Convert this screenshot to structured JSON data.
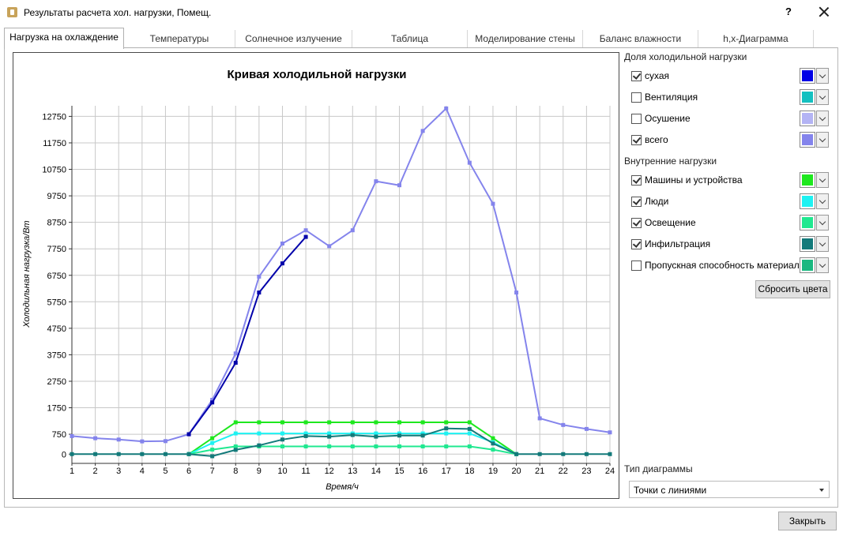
{
  "window": {
    "title": "Результаты расчета хол. нагрузки, Помещ.",
    "help": "?"
  },
  "tabs": [
    {
      "label": "Нагрузка на охлаждение",
      "active": true
    },
    {
      "label": "Температуры"
    },
    {
      "label": "Солнечное излучение"
    },
    {
      "label": "Таблица"
    },
    {
      "label": "Моделирование стены"
    },
    {
      "label": "Баланс влажности"
    },
    {
      "label": "h,x-Диаграмма"
    }
  ],
  "panel": {
    "cooling_section": "Доля холодильной нагрузки",
    "cooling_items": [
      {
        "label": "сухая",
        "checked": true,
        "color": "#0000e6"
      },
      {
        "label": "Вентиляция",
        "checked": false,
        "color": "#14c0c0"
      },
      {
        "label": "Осушение",
        "checked": false,
        "color": "#b4b4f4"
      },
      {
        "label": "всего",
        "checked": true,
        "color": "#8484ec"
      }
    ],
    "internal_section": "Внутренние нагрузки",
    "internal_items": [
      {
        "label": "Машины и устройства",
        "checked": true,
        "color": "#1ee81e"
      },
      {
        "label": "Люди",
        "checked": true,
        "color": "#1ef2f2"
      },
      {
        "label": "Освещение",
        "checked": true,
        "color": "#20e890"
      },
      {
        "label": "Инфильтрация",
        "checked": true,
        "color": "#137a7a"
      },
      {
        "label": "Пропускная способность материала",
        "checked": false,
        "color": "#1ab880"
      }
    ],
    "reset_button": "Сбросить цвета",
    "chart_type_label": "Тип диаграммы",
    "chart_type_value": "Точки с линиями"
  },
  "footer": {
    "close_button": "Закрыть"
  },
  "chart_data": {
    "type": "line",
    "title": "Кривая холодильной нагрузки",
    "xlabel": "Время/ч",
    "ylabel": "Холодильная нагрузка/Вт",
    "x": [
      1,
      2,
      3,
      4,
      5,
      6,
      7,
      8,
      9,
      10,
      11,
      12,
      13,
      14,
      15,
      16,
      17,
      18,
      19,
      20,
      21,
      22,
      23,
      24
    ],
    "xlim": [
      1,
      24
    ],
    "ylim": [
      -350,
      13150
    ],
    "yticks": [
      0,
      750,
      1750,
      2750,
      3750,
      4750,
      5750,
      6750,
      7750,
      8750,
      9750,
      10750,
      11750,
      12750
    ],
    "grid": true,
    "series": [
      {
        "name": "всего",
        "color": "#8484ec",
        "values": [
          680,
          600,
          550,
          480,
          490,
          750,
          2050,
          3800,
          6700,
          7950,
          8450,
          7850,
          8450,
          10300,
          10150,
          12200,
          13050,
          11000,
          9450,
          6100,
          1350,
          1100,
          950,
          820
        ]
      },
      {
        "name": "сухая",
        "color": "#0000aa",
        "values": [
          null,
          null,
          null,
          null,
          null,
          750,
          1950,
          3450,
          6100,
          7200,
          8200,
          null,
          null,
          null,
          null,
          null,
          null,
          null,
          null,
          null,
          null,
          null,
          null,
          null
        ]
      },
      {
        "name": "Машины и устройства",
        "color": "#1ee81e",
        "values": [
          null,
          null,
          null,
          null,
          null,
          0,
          600,
          1200,
          1200,
          1200,
          1200,
          1200,
          1200,
          1200,
          1200,
          1200,
          1200,
          1200,
          600,
          0,
          null,
          null,
          null,
          null
        ]
      },
      {
        "name": "Люди",
        "color": "#1ef2f2",
        "values": [
          null,
          null,
          null,
          null,
          null,
          0,
          420,
          780,
          780,
          780,
          780,
          780,
          780,
          780,
          780,
          780,
          780,
          780,
          450,
          0,
          null,
          null,
          null,
          null
        ]
      },
      {
        "name": "Освещение",
        "color": "#20e890",
        "values": [
          null,
          null,
          null,
          null,
          null,
          0,
          170,
          290,
          290,
          290,
          290,
          290,
          290,
          290,
          290,
          290,
          290,
          290,
          170,
          0,
          null,
          null,
          null,
          null
        ]
      },
      {
        "name": "Инфильтрация",
        "color": "#137a7a",
        "values": [
          0,
          0,
          0,
          0,
          0,
          0,
          -80,
          160,
          330,
          550,
          680,
          660,
          720,
          660,
          700,
          700,
          970,
          950,
          400,
          0,
          0,
          0,
          0,
          0
        ]
      }
    ]
  }
}
